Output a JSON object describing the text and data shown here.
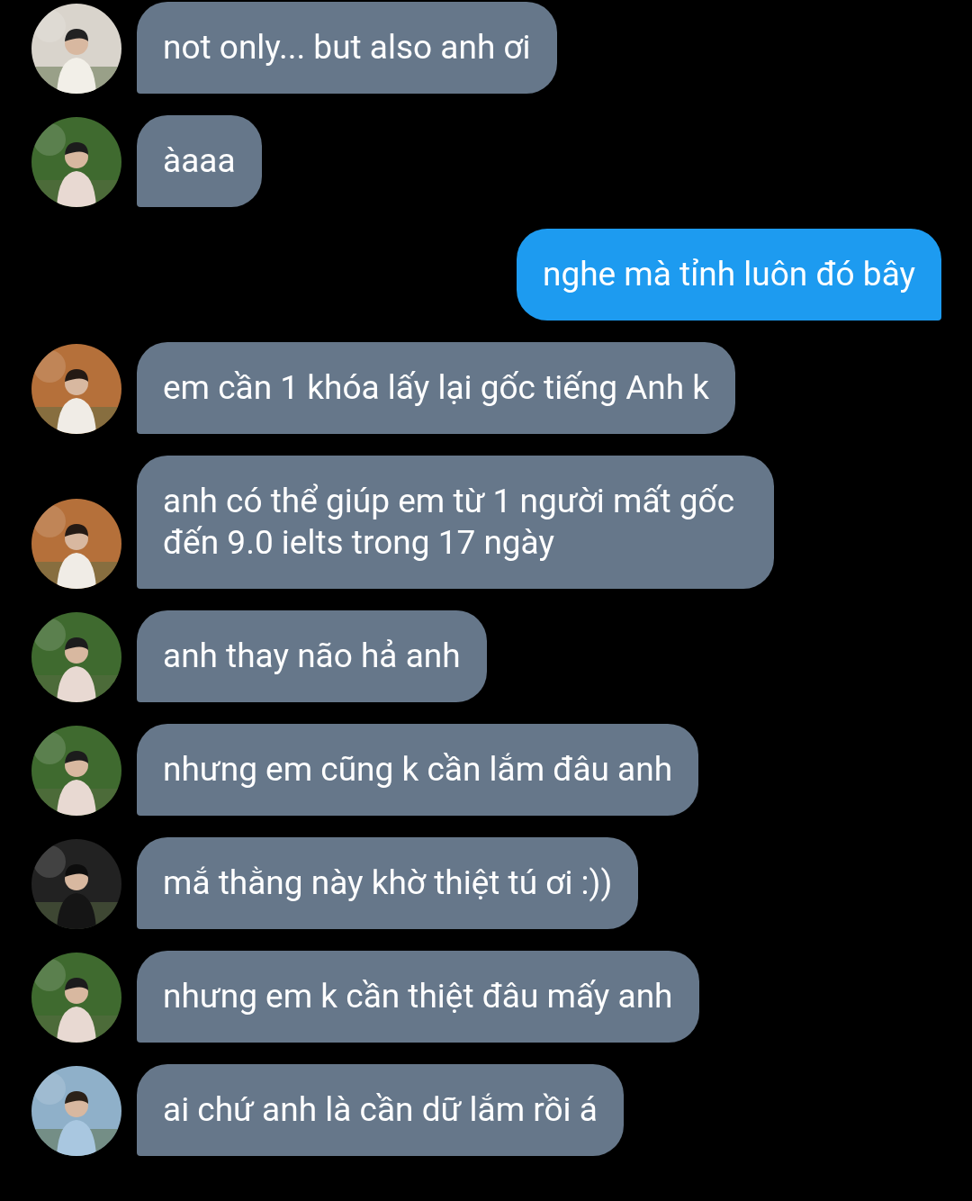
{
  "messages": [
    {
      "kind": "received",
      "text": "not only... but also anh ơi"
    },
    {
      "kind": "received",
      "text": "àaaa"
    },
    {
      "kind": "sent",
      "text": "nghe mà tỉnh luôn đó bây"
    },
    {
      "kind": "received",
      "text": "em cần 1 khóa lấy lại gốc tiếng Anh k"
    },
    {
      "kind": "received",
      "text": "anh có thể giúp em từ 1 người mất gốc đến 9.0 ielts trong 17 ngày"
    },
    {
      "kind": "received",
      "text": "anh thay não hả anh"
    },
    {
      "kind": "received",
      "text": "nhưng em cũng k cần lắm đâu anh"
    },
    {
      "kind": "received",
      "text": "mắ thằng này khờ thiệt tú ơi :))"
    },
    {
      "kind": "received",
      "text": "nhưng em k cần thiệt đâu mấy anh"
    },
    {
      "kind": "received",
      "text": "ai chứ anh là cần dữ lắm rồi á"
    }
  ]
}
